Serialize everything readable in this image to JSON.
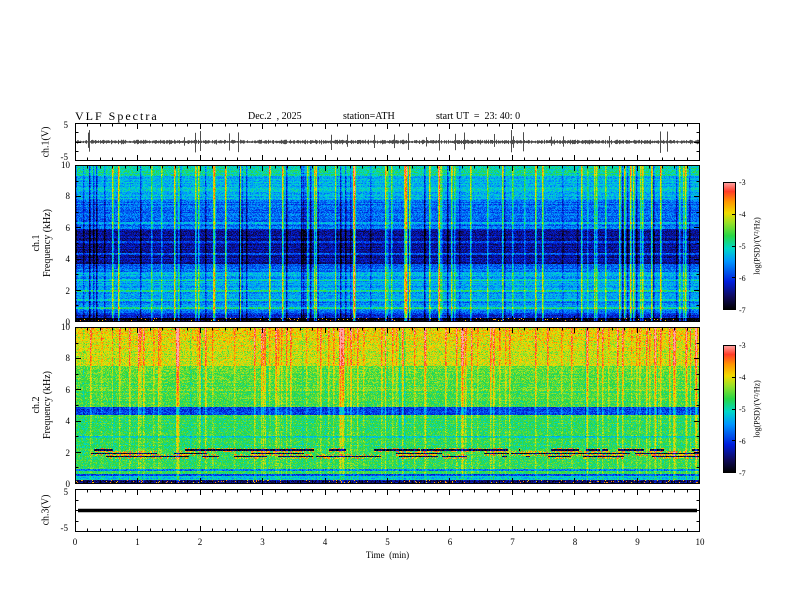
{
  "header": {
    "title": "VLF Spectra",
    "date": "Dec.2  , 2025",
    "station": "station=ATH",
    "start_ut": "start UT  =  23: 40: 0"
  },
  "panels": {
    "ch1wave": {
      "label": "ch.1(V)",
      "ytop": "5",
      "ybottom": "-5"
    },
    "ch1spec": {
      "channel": "ch.1",
      "axis": "Frequency  (kHz)",
      "ticks": [
        "10",
        "8",
        "6",
        "4",
        "2",
        "0"
      ]
    },
    "ch2spec": {
      "channel": "ch.2",
      "axis": "Frequency  (kHz)",
      "ticks": [
        "10",
        "8",
        "6",
        "4",
        "2",
        "0"
      ]
    },
    "ch3wave": {
      "label": "ch.3(V)",
      "ytop": "5",
      "ybottom": "-5"
    }
  },
  "xaxis": {
    "label": "Time  (min)",
    "ticks": [
      "0",
      "1",
      "2",
      "3",
      "4",
      "5",
      "6",
      "7",
      "8",
      "9",
      "10"
    ]
  },
  "colorbars": [
    {
      "label": "log(PSD)/(V²/Hz)",
      "ticks": [
        "-3",
        "-4",
        "-5",
        "-6",
        "-7"
      ]
    },
    {
      "label": "log(PSD)/(V²/Hz)",
      "ticks": [
        "-3",
        "-4",
        "-5",
        "-6",
        "-7"
      ]
    }
  ],
  "chart_data": [
    {
      "id": "ch1_wave",
      "type": "line",
      "title": "ch.1 voltage time series",
      "xlabel": "Time (min)",
      "ylabel": "ch.1(V)",
      "xlim": [
        0,
        10
      ],
      "ylim": [
        -5,
        5
      ],
      "description": "Broadband noise centred on 0 V, amplitude about ±0.5 V, with frequent impulsive sferic spikes reaching about ±2.5 V across the full 10 minutes",
      "noise_v": 0.5,
      "spike_prob": 0.05,
      "spike_v": 2.4,
      "seed": 101
    },
    {
      "id": "ch1_spec",
      "type": "heatmap",
      "title": "ch.1 VLF spectrogram",
      "xlabel": "Time (min)",
      "ylabel": "Frequency (kHz)",
      "zlabel": "log(PSD)/(V²/Hz)",
      "xlim": [
        0,
        10
      ],
      "ylim": [
        0,
        10
      ],
      "zlim": [
        -7,
        -3
      ],
      "description": "Mostly blue/cyan PSD near -5.5; dark-blue quiet band ~3.7-5.9 kHz near -6.3; brighter cyan-green above 8 kHz; dense bright (sferic) and dark vertical streaks; very low PSD strip below 0.25 kHz with sparse red speckles",
      "seed": 202,
      "bands": [
        [
          0,
          0.25,
          -6.9
        ],
        [
          0.25,
          0.6,
          -6.1
        ],
        [
          0.6,
          1.6,
          -5.55
        ],
        [
          1.6,
          3.2,
          -5.4
        ],
        [
          3.2,
          3.7,
          -5.75
        ],
        [
          3.7,
          5.9,
          -6.35
        ],
        [
          5.9,
          7.8,
          -5.7
        ],
        [
          7.8,
          9.3,
          -5.3
        ],
        [
          9.3,
          10.01,
          -5.0
        ]
      ],
      "lines": [
        [
          0.9,
          -4.95
        ],
        [
          1.4,
          -5.05
        ],
        [
          2.0,
          -4.95
        ],
        [
          2.7,
          -5.05
        ],
        [
          3.1,
          -5.15
        ],
        [
          4.35,
          -5.9
        ],
        [
          5.1,
          -5.9
        ],
        [
          6.3,
          -5.45
        ]
      ],
      "bright_streak_prob": 0.09,
      "bright_streak_boost": 1.5,
      "dark_streak_prob": 0.05,
      "dark_streak_delta": -0.7,
      "streak_freq_weight": false,
      "top_boost": 0,
      "pixel_noise": 0.28,
      "row_noise": 0.18,
      "bottom_speckle_prob": 0.05
    },
    {
      "id": "ch2_spec",
      "type": "heatmap",
      "title": "ch.2 VLF spectrogram",
      "xlabel": "Time (min)",
      "ylabel": "Frequency (kHz)",
      "zlabel": "log(PSD)/(V²/Hz)",
      "xlim": [
        0,
        10
      ],
      "ylim": [
        0,
        10
      ],
      "zlim": [
        -7,
        -3
      ],
      "description": "Mostly green PSD near -4.7; yellow/orange/red patches above ~6 kHz; dark quiet band 4.4-4.9 kHz; intermittent dark dashed interference lines near 1.75/1.95/2.15 kHz rimmed with red; very low strip below 0.25 kHz with red speckles",
      "seed": 303,
      "bands": [
        [
          0,
          0.25,
          -6.6
        ],
        [
          0.25,
          0.55,
          -5.2
        ],
        [
          0.55,
          4.4,
          -4.72
        ],
        [
          4.4,
          4.9,
          -5.95
        ],
        [
          4.9,
          7.5,
          -4.6
        ],
        [
          7.5,
          10.01,
          -4.35
        ]
      ],
      "lines": [
        [
          0.55,
          -5.9
        ],
        [
          0.9,
          -5.6
        ],
        [
          3.0,
          -5.15
        ],
        [
          6.0,
          -4.4
        ]
      ],
      "dashed_lines": [
        [
          1.75,
          -6.8
        ],
        [
          1.95,
          -6.8
        ],
        [
          2.15,
          -6.8
        ]
      ],
      "bright_streak_prob": 0.16,
      "bright_streak_boost": 1.0,
      "dark_streak_prob": 0.02,
      "dark_streak_delta": -0.4,
      "streak_freq_weight": true,
      "top_boost": 0.45,
      "pixel_noise": 0.3,
      "row_noise": 0.12,
      "bottom_speckle_prob": 0.08
    },
    {
      "id": "ch3_wave",
      "type": "line",
      "title": "ch.3 voltage time series",
      "xlabel": "Time (min)",
      "ylabel": "ch.3(V)",
      "xlim": [
        0,
        10
      ],
      "ylim": [
        -5,
        5
      ],
      "description": "Flat (inactive) channel: constant thick line at 0 V",
      "flat_value": 0,
      "seed": 404
    }
  ]
}
